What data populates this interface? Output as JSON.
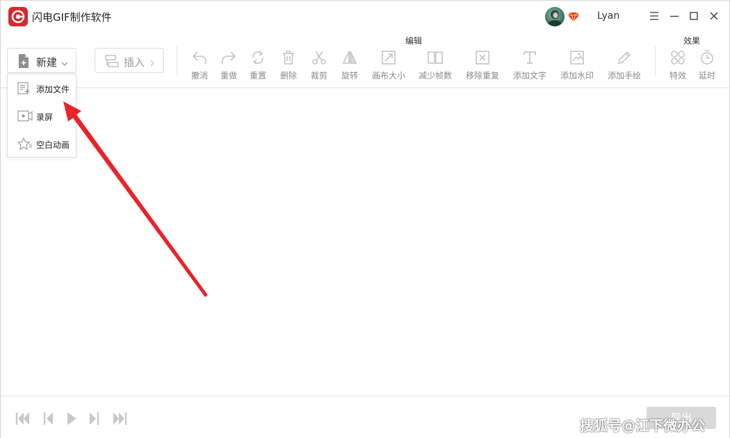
{
  "window": {
    "title": "闪电GIF制作软件",
    "username": "Lyan"
  },
  "colors": {
    "brand_red": "#d8282f",
    "arrow_red": "#e8232a",
    "disabled_gray": "#b8b8b8"
  },
  "toolbar": {
    "new_label": "新建",
    "insert_label": "插入",
    "edit_group_label": "编辑",
    "effects_group_label": "效果",
    "edit_tools": [
      {
        "label": "撤消",
        "icon": "undo-icon"
      },
      {
        "label": "重做",
        "icon": "redo-icon"
      },
      {
        "label": "重置",
        "icon": "reset-icon"
      },
      {
        "label": "删除",
        "icon": "trash-icon"
      },
      {
        "label": "裁剪",
        "icon": "scissors-icon"
      },
      {
        "label": "旋转",
        "icon": "rotate-icon"
      },
      {
        "label": "画布大小",
        "icon": "canvas-size-icon"
      },
      {
        "label": "减少帧数",
        "icon": "reduce-frames-icon"
      },
      {
        "label": "移除重复",
        "icon": "remove-duplicate-icon"
      },
      {
        "label": "添加文字",
        "icon": "text-icon"
      },
      {
        "label": "添加水印",
        "icon": "watermark-icon"
      },
      {
        "label": "添加手绘",
        "icon": "pencil-icon"
      }
    ],
    "effect_tools": [
      {
        "label": "特效",
        "icon": "effects-icon"
      },
      {
        "label": "延时",
        "icon": "timer-icon"
      }
    ]
  },
  "new_menu": {
    "items": [
      {
        "label": "添加文件",
        "icon": "add-file-icon"
      },
      {
        "label": "录屏",
        "icon": "screen-record-icon"
      },
      {
        "label": "空白动画",
        "icon": "blank-animation-icon"
      }
    ]
  },
  "bottom": {
    "export_label": "导出",
    "watermark_text": "搜狐号@江下微办公"
  }
}
